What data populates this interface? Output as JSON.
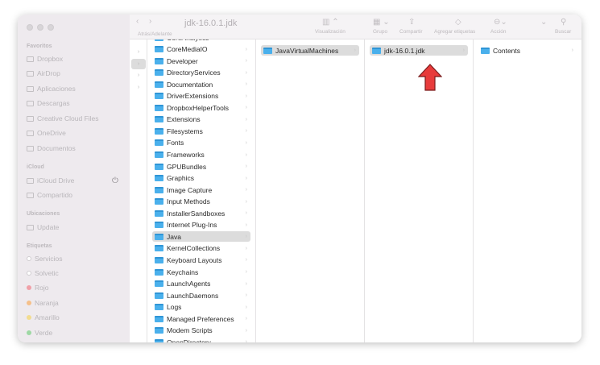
{
  "window": {
    "title": "jdk-16.0.1.jdk",
    "nav_label": "Atrás/Adelante"
  },
  "toolbar": {
    "view": "Visualización",
    "group": "Grupo",
    "share": "Compartir",
    "tags": "Agregar etiquetas",
    "action": "Acción",
    "search": "Buscar"
  },
  "sidebar": {
    "favorites_header": "Favoritos",
    "favorites": [
      "Dropbox",
      "AirDrop",
      "Aplicaciones",
      "Descargas",
      "Creative Cloud Files",
      "OneDrive",
      "Documentos"
    ],
    "icloud_header": "iCloud",
    "icloud": [
      "iCloud Drive",
      "Compartido"
    ],
    "locations_header": "Ubicaciones",
    "locations": [
      "Update"
    ],
    "tags_header": "Etiquetas",
    "tags": [
      {
        "label": "Servicios",
        "color": "#ffffff"
      },
      {
        "label": "Solvetic",
        "color": "#ffffff"
      },
      {
        "label": "Rojo",
        "color": "#f0a0a8"
      },
      {
        "label": "Naranja",
        "color": "#f5c08a"
      },
      {
        "label": "Amarillo",
        "color": "#f2dc90"
      },
      {
        "label": "Verde",
        "color": "#9ed8a4"
      }
    ]
  },
  "column2": [
    "CoreAnalytics",
    "CoreMediaIO",
    "Developer",
    "DirectoryServices",
    "Documentation",
    "DriverExtensions",
    "DropboxHelperTools",
    "Extensions",
    "Filesystems",
    "Fonts",
    "Frameworks",
    "GPUBundles",
    "Graphics",
    "Image Capture",
    "Input Methods",
    "InstallerSandboxes",
    "Internet Plug-Ins",
    "Java",
    "KernelCollections",
    "Keyboard Layouts",
    "Keychains",
    "LaunchAgents",
    "LaunchDaemons",
    "Logs",
    "Managed Preferences",
    "Modem Scripts",
    "OpenDirectory"
  ],
  "column3": [
    "JavaVirtualMachines"
  ],
  "column4": [
    "jdk-16.0.1.jdk"
  ],
  "column5": [
    "Contents"
  ],
  "selected_col2": "Java"
}
